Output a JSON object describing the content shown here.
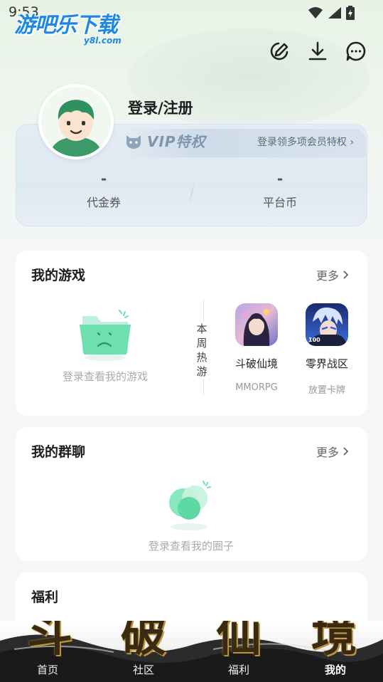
{
  "status_bar": {
    "time": "9:53"
  },
  "app": {
    "logo_text": "游吧乐下载",
    "logo_sub": "y8l.com"
  },
  "profile": {
    "login_label": "登录/注册",
    "vip_label": "VIP特权",
    "vip_promo": "登录领多项会员特权",
    "stats": [
      {
        "value": "-",
        "label": "代金券"
      },
      {
        "value": "-",
        "label": "平台币"
      }
    ]
  },
  "my_games": {
    "title": "我的游戏",
    "more": "更多",
    "empty_text": "登录查看我的游戏",
    "weekly_label": "本周热游",
    "games": [
      {
        "name": "斗破仙境",
        "tag": "MMORPG"
      },
      {
        "name": "零界战区",
        "tag": "放置卡牌"
      }
    ]
  },
  "my_groups": {
    "title": "我的群聊",
    "more": "更多",
    "empty_text": "登录查看我的圈子"
  },
  "welfare": {
    "title": "福利"
  },
  "bottom_nav": {
    "brush_chars": [
      "斗",
      "破",
      "仙",
      "境"
    ],
    "tabs": [
      {
        "label": "首页",
        "active": false
      },
      {
        "label": "社区",
        "active": false
      },
      {
        "label": "福利",
        "active": false
      },
      {
        "label": "我的",
        "active": true
      }
    ]
  },
  "colors": {
    "accent_green": "#47c98a",
    "logo_blue": "#1e88e5",
    "vip_gray": "#7e95ad"
  },
  "icons": [
    "edit-icon",
    "download-icon",
    "message-icon",
    "wifi-icon",
    "signal-icon",
    "battery-icon",
    "chevron-right-icon",
    "vip-cat-icon"
  ]
}
